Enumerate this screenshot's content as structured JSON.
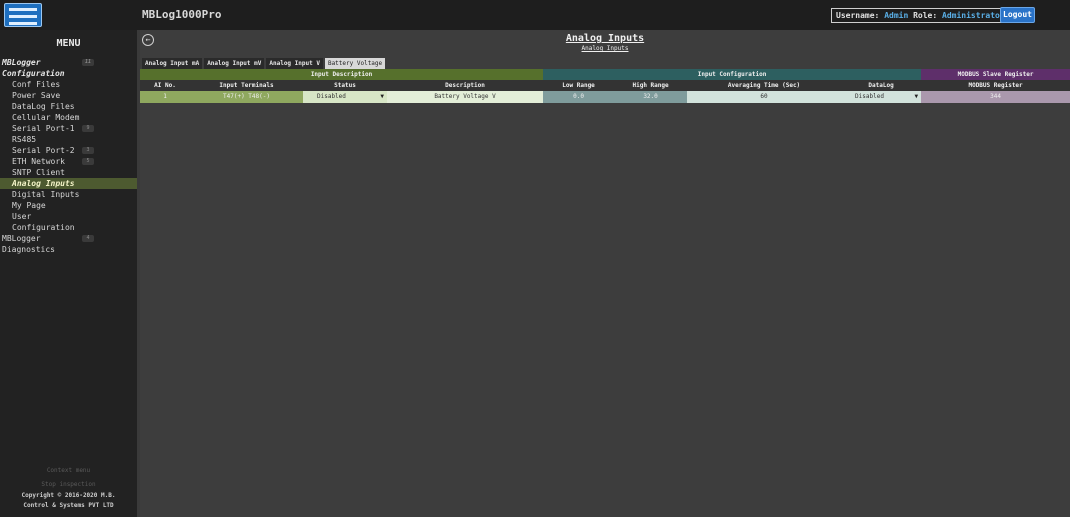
{
  "app": {
    "title": "MBLog1000Pro"
  },
  "user": {
    "username_label": "Username:",
    "username": "Admin",
    "role_label": "Role:",
    "role": "Administrator",
    "logout_label": "Logout"
  },
  "sidebar": {
    "title": "MENU",
    "items": [
      {
        "label": "MBLogger",
        "badge": "11"
      },
      {
        "label": "Configuration"
      },
      {
        "label": "Conf Files"
      },
      {
        "label": "Power Save"
      },
      {
        "label": "DataLog Files"
      },
      {
        "label": "Cellular Modem"
      },
      {
        "label": "Serial Port-1",
        "badge": "9"
      },
      {
        "label": "RS485"
      },
      {
        "label": "Serial Port-2",
        "badge": "3"
      },
      {
        "label": "ETH Network",
        "badge": "5"
      },
      {
        "label": "SNTP Client"
      },
      {
        "label": "Analog Inputs"
      },
      {
        "label": "Digital Inputs"
      },
      {
        "label": "My Page"
      },
      {
        "label": "User"
      },
      {
        "label": "Configuration"
      },
      {
        "label": "MBLogger",
        "badge": "4"
      },
      {
        "label": "Diagnostics"
      }
    ],
    "footer": {
      "context_menu": "Context menu",
      "stop_inspection": "Stop inspection",
      "copyright_line1": "Copyright © 2016-2020 M.B.",
      "copyright_line2": "Control & Systems PVT LTD"
    }
  },
  "main": {
    "title": "Analog Inputs",
    "subtitle": "Analog Inputs",
    "back_icon": "back-arrow-icon",
    "tabs": [
      {
        "label": "Analog Input mA",
        "active": false
      },
      {
        "label": "Analog Input mV",
        "active": false
      },
      {
        "label": "Analog Input V",
        "active": false
      },
      {
        "label": "Battery Voltage",
        "active": true
      }
    ],
    "table": {
      "groups": {
        "input_description": "Input Description",
        "input_configuration": "Input Configuration",
        "modbus_slave": "MODBUS Slave Register"
      },
      "columns": {
        "ai_no": "AI No.",
        "input_terminals": "Input Terminals",
        "status": "Status",
        "description": "Description",
        "low_range": "Low Range",
        "high_range": "High Range",
        "averaging_time": "Averaging Time (Sec)",
        "datalog": "DataLog",
        "modbus_register": "MODBUS Register"
      },
      "rows": [
        {
          "ai_no": "1",
          "input_terminals": "T47(+) T48(-)",
          "status": "Disabled",
          "description": "Battery Voltage V",
          "low_range": "0.0",
          "high_range": "32.0",
          "averaging_time": "60",
          "datalog": "Disabled",
          "modbus_register": "344"
        }
      ]
    }
  },
  "colors": {
    "input_description_header": "#56702c",
    "input_configuration_header": "#2d5f60",
    "modbus_header": "#5e2f6a",
    "active_menu": "#4d5a30",
    "logout_button": "#2a73c8"
  }
}
